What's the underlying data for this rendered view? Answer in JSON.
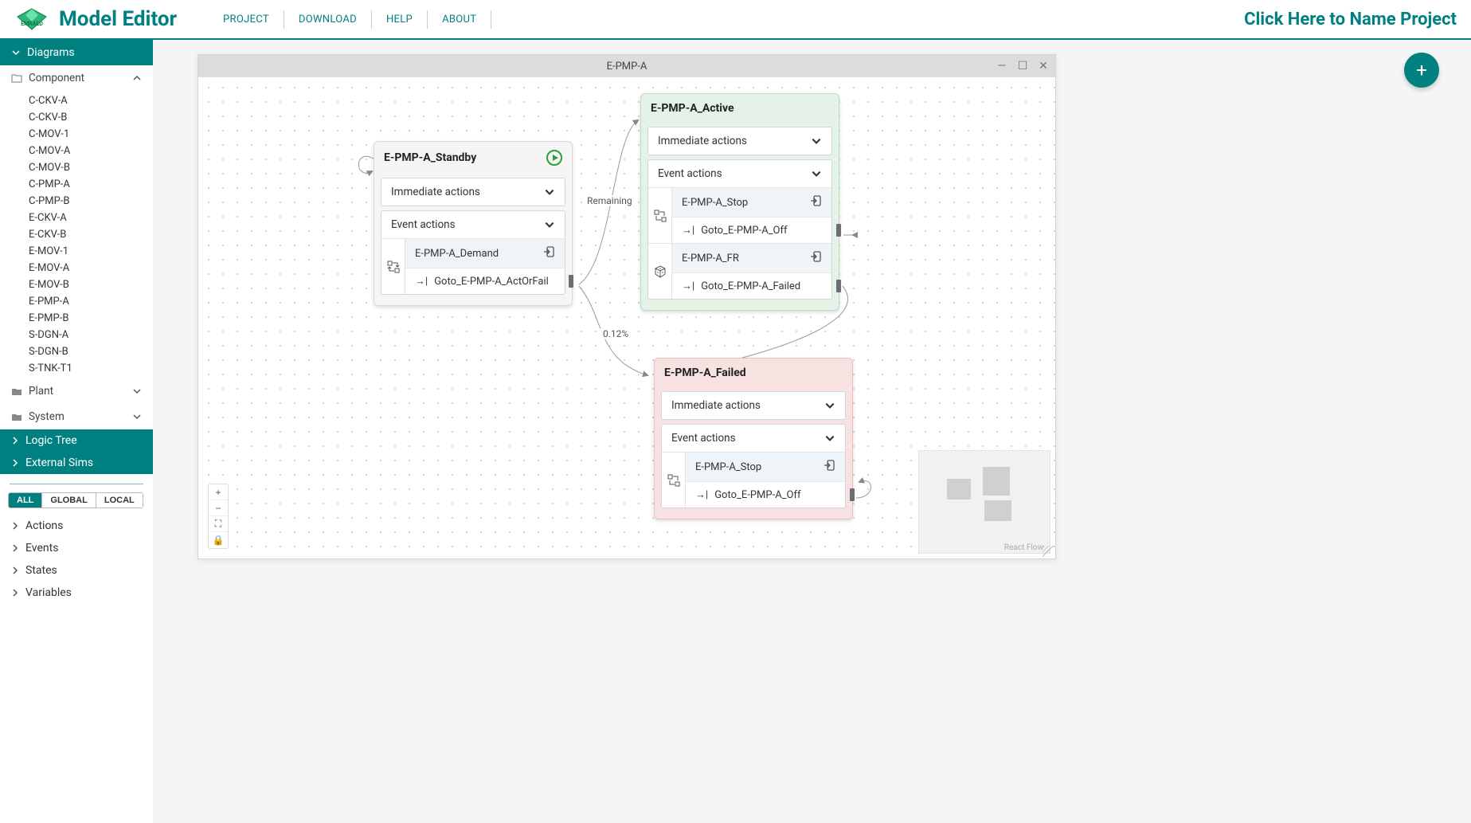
{
  "app": {
    "title": "Model Editor"
  },
  "nav": {
    "project": "PROJECT",
    "download": "DOWNLOAD",
    "help": "HELP",
    "about": "ABOUT"
  },
  "projectName": "Click Here to Name Project",
  "sidebar": {
    "diagrams": {
      "label": "Diagrams"
    },
    "groups": [
      {
        "label": "Component",
        "expanded": true,
        "items": [
          "C-CKV-A",
          "C-CKV-B",
          "C-MOV-1",
          "C-MOV-A",
          "C-MOV-B",
          "C-PMP-A",
          "C-PMP-B",
          "E-CKV-A",
          "E-CKV-B",
          "E-MOV-1",
          "E-MOV-A",
          "E-MOV-B",
          "E-PMP-A",
          "E-PMP-B",
          "S-DGN-A",
          "S-DGN-B",
          "S-TNK-T1"
        ]
      },
      {
        "label": "Plant",
        "expanded": false
      },
      {
        "label": "System",
        "expanded": false
      }
    ],
    "logicTree": "Logic Tree",
    "externalSims": "External Sims",
    "scope": {
      "all": "ALL",
      "global": "GLOBAL",
      "local": "LOCAL",
      "active": "ALL"
    },
    "bottom": {
      "actions": "Actions",
      "events": "Events",
      "states": "States",
      "variables": "Variables"
    }
  },
  "window": {
    "title": "E-PMP-A",
    "edgeLabels": {
      "remaining": "Remaining",
      "prob": "0.12%"
    },
    "attribution": "React Flow",
    "nodes": [
      {
        "id": "standby",
        "title": "E-PMP-A_Standby",
        "start": true,
        "sections": {
          "immediate": {
            "label": "Immediate actions"
          },
          "events": {
            "label": "Event actions",
            "items": [
              {
                "icon": "state-change",
                "title": "E-PMP-A_Demand",
                "action": "Goto_E-PMP-A_ActOrFail"
              }
            ]
          }
        }
      },
      {
        "id": "active",
        "title": "E-PMP-A_Active",
        "sections": {
          "immediate": {
            "label": "Immediate actions"
          },
          "events": {
            "label": "Event actions",
            "items": [
              {
                "icon": "state-change",
                "title": "E-PMP-A_Stop",
                "action": "Goto_E-PMP-A_Off"
              },
              {
                "icon": "dice",
                "title": "E-PMP-A_FR",
                "action": "Goto_E-PMP-A_Failed"
              }
            ]
          }
        }
      },
      {
        "id": "failed",
        "title": "E-PMP-A_Failed",
        "sections": {
          "immediate": {
            "label": "Immediate actions"
          },
          "events": {
            "label": "Event actions",
            "items": [
              {
                "icon": "state-change",
                "title": "E-PMP-A_Stop",
                "action": "Goto_E-PMP-A_Off"
              }
            ]
          }
        }
      }
    ]
  }
}
